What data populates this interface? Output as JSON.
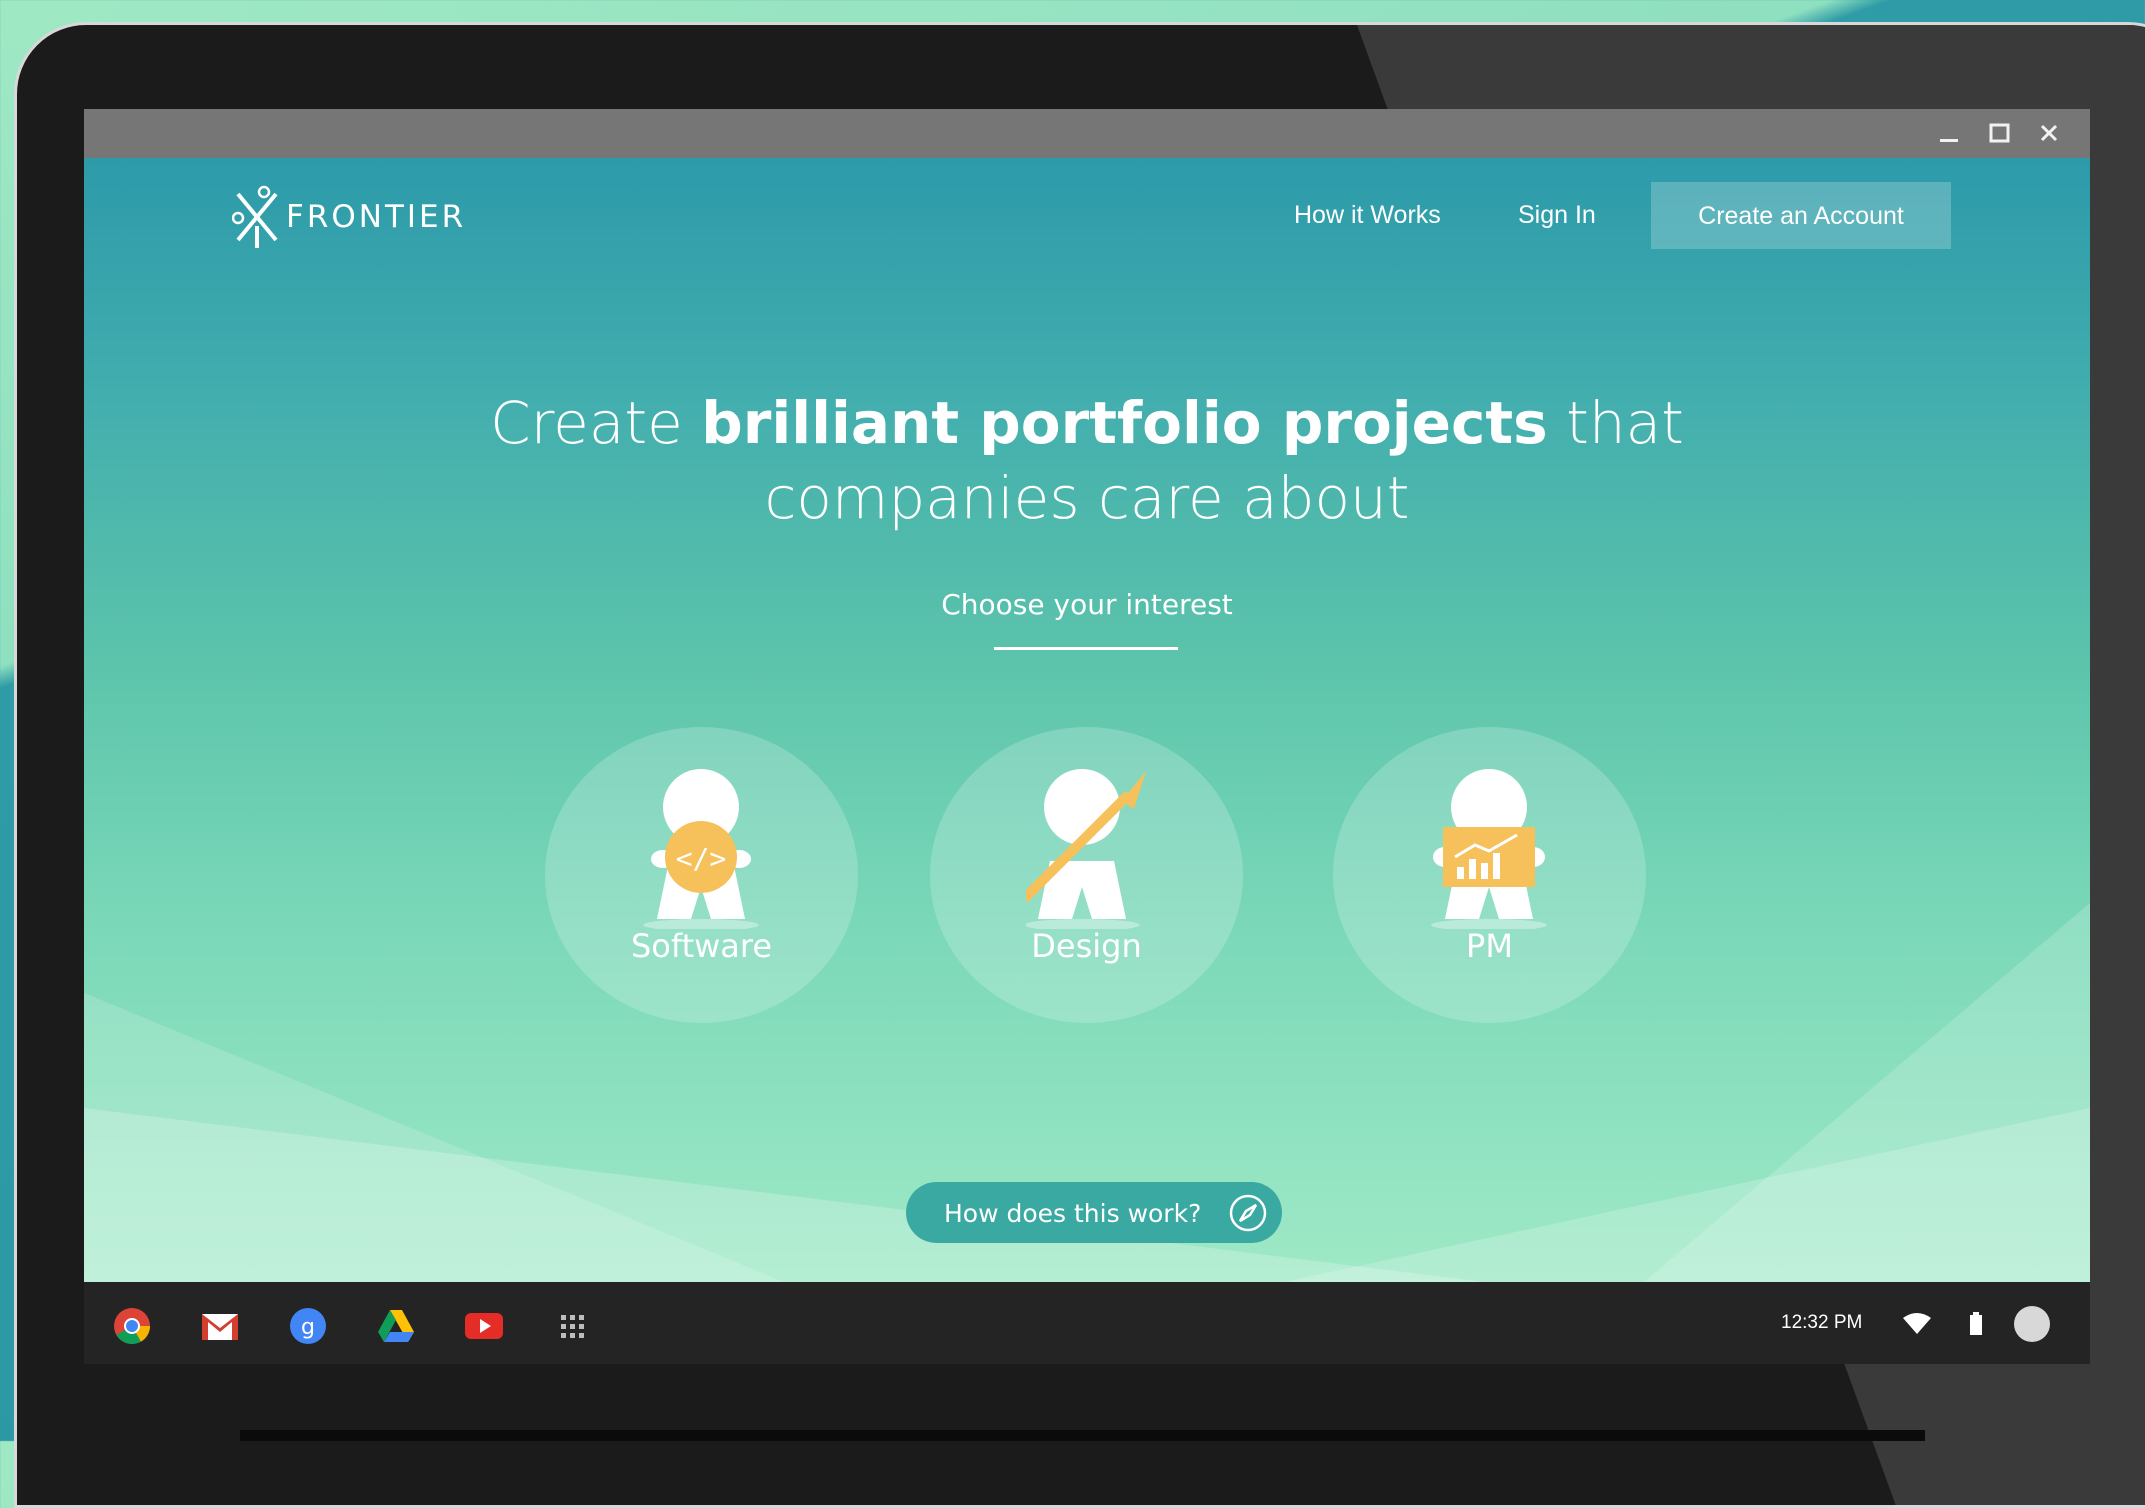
{
  "window": {
    "minimize_icon": "minimize-icon",
    "maximize_icon": "maximize-icon",
    "close_icon": "close-icon"
  },
  "header": {
    "logo_text": "FRONTIER",
    "nav": [
      {
        "label": "How it Works"
      },
      {
        "label": "Sign In"
      }
    ],
    "cta_label": "Create an Account"
  },
  "hero": {
    "pre": "Create",
    "bold": "brilliant portfolio projects",
    "post": "that",
    "line2": "companies care about"
  },
  "interest": {
    "heading": "Choose your interest",
    "options": [
      {
        "label": "Software",
        "icon": "code-badge-icon"
      },
      {
        "label": "Design",
        "icon": "paintbrush-icon"
      },
      {
        "label": "PM",
        "icon": "chart-board-icon"
      }
    ]
  },
  "how_button": {
    "label": "How does this work?",
    "icon": "compass-icon"
  },
  "shelf": {
    "apps": [
      "chrome-icon",
      "gmail-icon",
      "google-plus-icon",
      "drive-icon",
      "youtube-icon",
      "app-launcher-icon"
    ],
    "time": "12:32 PM",
    "status_icons": [
      "wifi-icon",
      "battery-icon",
      "account-avatar"
    ]
  },
  "colors": {
    "accent_button": "#3aa9a1",
    "figure_orange": "#f6c15a"
  }
}
